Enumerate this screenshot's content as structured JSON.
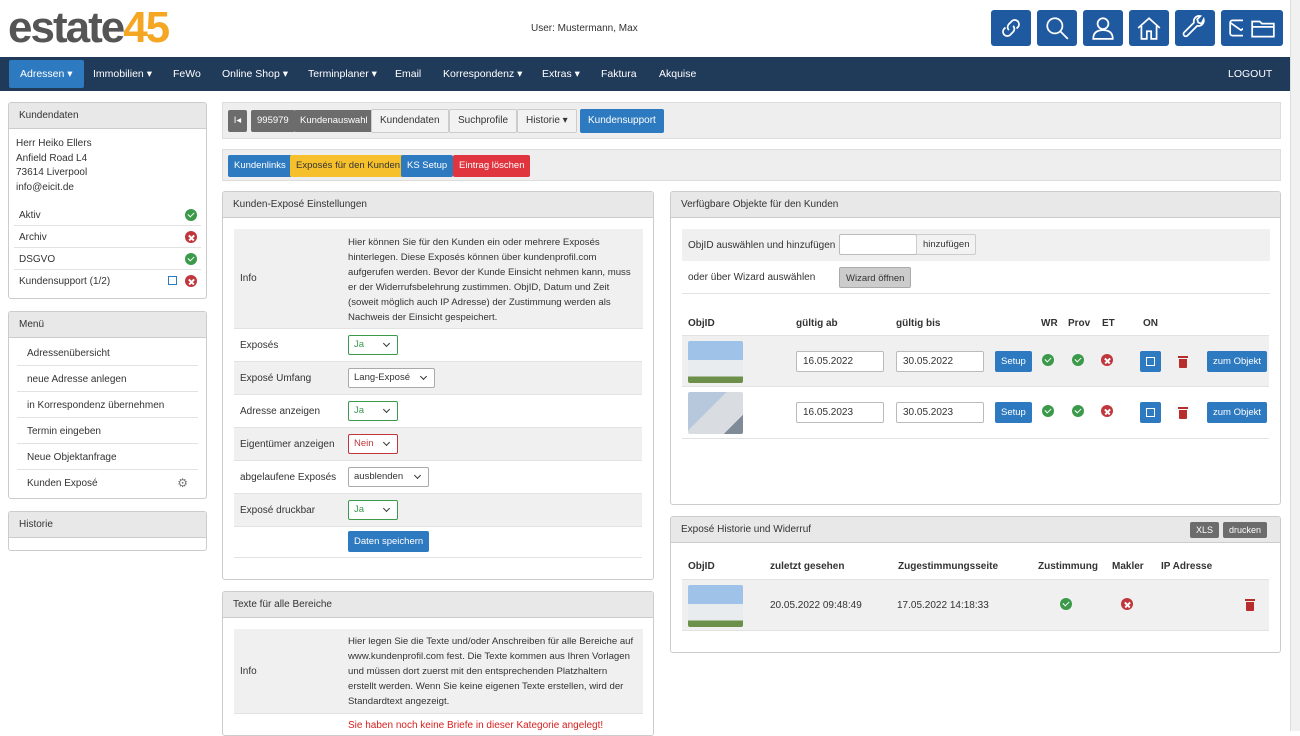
{
  "logo": {
    "part1": "estate",
    "part2": "45"
  },
  "user": "User: Mustermann, Max",
  "toolbar_icons": [
    "link-icon",
    "search-icon",
    "user-icon",
    "home-icon",
    "wrench-icon",
    "mail-icon",
    "folder-icon"
  ],
  "nav": {
    "items": [
      "Adressen",
      "Immobilien",
      "FeWo",
      "Online Shop",
      "Terminplaner",
      "Email",
      "Korrespondenz",
      "Extras",
      "Faktura",
      "Akquise"
    ],
    "logout": "LOGOUT"
  },
  "customer": {
    "title": "Kundendaten",
    "name": "Herr Heiko Ellers",
    "street": "Anfield Road L4",
    "city": "73614 Liverpool",
    "email": "info@eicit.de",
    "status": [
      {
        "label": "Aktiv",
        "state": "ok"
      },
      {
        "label": "Archiv",
        "state": "no"
      },
      {
        "label": "DSGVO",
        "state": "ok"
      },
      {
        "label": "Kundensupport (1/2)",
        "state": "no"
      }
    ]
  },
  "menu": {
    "title": "Menü",
    "items": [
      "Adressenübersicht",
      "neue Adresse anlegen",
      "in Korrespondenz übernehmen",
      "Termin eingeben",
      "Neue Objektanfrage",
      "Kunden Exposé"
    ]
  },
  "history_panel": {
    "title": "Historie"
  },
  "tabs": {
    "id": "995979",
    "items": [
      "Kundenauswahl",
      "Kundendaten",
      "Suchprofile",
      "Historie",
      "Kundensupport"
    ]
  },
  "subtabs": [
    "Kundenlinks",
    "Exposés für den Kunden",
    "KS Setup",
    "Eintrag löschen"
  ],
  "settings": {
    "title": "Kunden-Exposé Einstellungen",
    "info_label": "Info",
    "info_text": "Hier können Sie für den Kunden ein oder mehrere Exposés hinterlegen. Diese Exposés können über kundenprofil.com aufgerufen werden. Bevor der Kunde Einsicht nehmen kann, muss er der Widerrufsbelehrung zustimmen. ObjID, Datum und Zeit (soweit möglich auch IP Adresse) der Zustimmung werden als Nachweis der Einsicht gespeichert.",
    "rows": [
      {
        "label": "Exposés",
        "value": "Ja"
      },
      {
        "label": "Exposé Umfang",
        "value": "Lang-Exposé"
      },
      {
        "label": "Adresse anzeigen",
        "value": "Ja"
      },
      {
        "label": "Eigentümer anzeigen",
        "value": "Nein"
      },
      {
        "label": "abgelaufene Exposés",
        "value": "ausblenden"
      },
      {
        "label": "Exposé druckbar",
        "value": "Ja"
      }
    ],
    "save": "Daten speichern"
  },
  "texts": {
    "title": "Texte für alle Bereiche",
    "info_label": "Info",
    "info_text": "Hier legen Sie die Texte und/oder Anschreiben für alle Bereiche auf www.kundenprofil.com fest. Die Texte kommen aus Ihren Vorlagen und müssen dort zuerst mit den entsprechenden Platzhaltern erstellt werden. Wenn Sie keine eigenen Texte erstellen, wird der Standardtext angezeigt.",
    "warning": "Sie haben noch keine Briefe in dieser Kategorie angelegt!"
  },
  "objects": {
    "title": "Verfügbare Objekte für den Kunden",
    "add_label": "ObjID auswählen und hinzufügen",
    "add_btn": "hinzufügen",
    "wizard_label": "oder über Wizard auswählen",
    "wizard_btn": "Wizard öffnen",
    "headers": [
      "ObjID",
      "gültig ab",
      "gültig bis",
      "WR",
      "Prov",
      "ET",
      "ON"
    ],
    "rows": [
      {
        "from": "16.05.2022",
        "to": "30.05.2022",
        "setup": "Setup",
        "wr": "ok",
        "prov": "ok",
        "et": "no",
        "btn": "zum Objekt"
      },
      {
        "from": "16.05.2023",
        "to": "30.05.2023",
        "setup": "Setup",
        "wr": "ok",
        "prov": "ok",
        "et": "no",
        "btn": "zum Objekt"
      }
    ]
  },
  "expo_history": {
    "title": "Exposé Historie und Widerruf",
    "xls": "XLS",
    "print": "drucken",
    "headers": [
      "ObjID",
      "zuletzt gesehen",
      "Zugestimmungsseite",
      "Zustimmung",
      "Makler",
      "IP Adresse"
    ],
    "rows": [
      {
        "seen": "20.05.2022 09:48:49",
        "agreed": "17.05.2022 14:18:33",
        "consent": "ok",
        "broker": "no"
      }
    ]
  }
}
